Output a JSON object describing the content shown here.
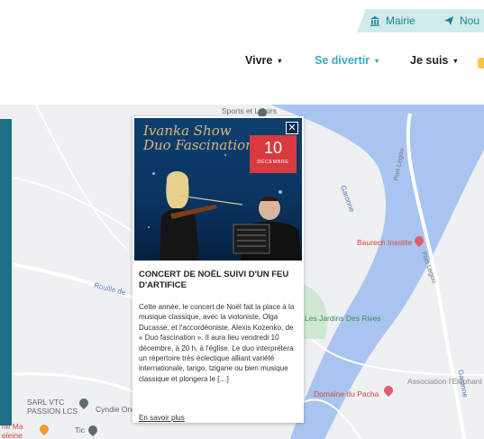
{
  "header": {
    "tabs": [
      {
        "label": "Mairie",
        "icon": "building-icon"
      },
      {
        "label": "Nou",
        "icon": "paper-plane-icon"
      }
    ],
    "nav": [
      {
        "label": "Vivre",
        "active": false
      },
      {
        "label": "Se divertir",
        "active": true
      },
      {
        "label": "Je suis",
        "active": false
      }
    ],
    "nav_chevron": "▾"
  },
  "map": {
    "labels": {
      "sports": "Sports et Loisirs",
      "jardins": "Les Jardins Des Rives",
      "sarl": "SARL VTC\nPASSION LCS",
      "cyndie": "Cyndie Ong",
      "pacha": "Domaine du Pacha",
      "asso": "Association l'Éléphant",
      "baurech": "Baurech Insolite",
      "garonne": "Garonne",
      "port_legou": "Port Legou",
      "rouille": "Rouille de",
      "mabel": "rie Ma\neleine",
      "tic": "Tic"
    }
  },
  "popup": {
    "image_title": "Ivanka Show\nDuo Fascination",
    "date_day": "10",
    "date_month": "DÉCEMBRE",
    "close_glyph": "✕",
    "title": "CONCERT DE NOËL SUIVI D'UN FEU D'ARTIFICE",
    "body": "Cette année, le concert de Noël fait la place à la musique classique, avec la violoniste, Olga Ducasse, et l'accordéoniste, Alexis Kozenko, de « Duo fascination ». Il aura lieu vendredi 10 décembre, à 20 h, à l'église. Le duo interprétera un répertoire très éclectique alliant variété internationale, tango, tzigane ou bien musique classique et plongera le […]",
    "more_link": "En savoir plus"
  },
  "colors": {
    "accent": "#3ea9c6",
    "tab_bg": "#cfeceb",
    "date_badge": "#d93a3e",
    "river": "#a9c4f0",
    "map_bg": "#eef0f2"
  }
}
